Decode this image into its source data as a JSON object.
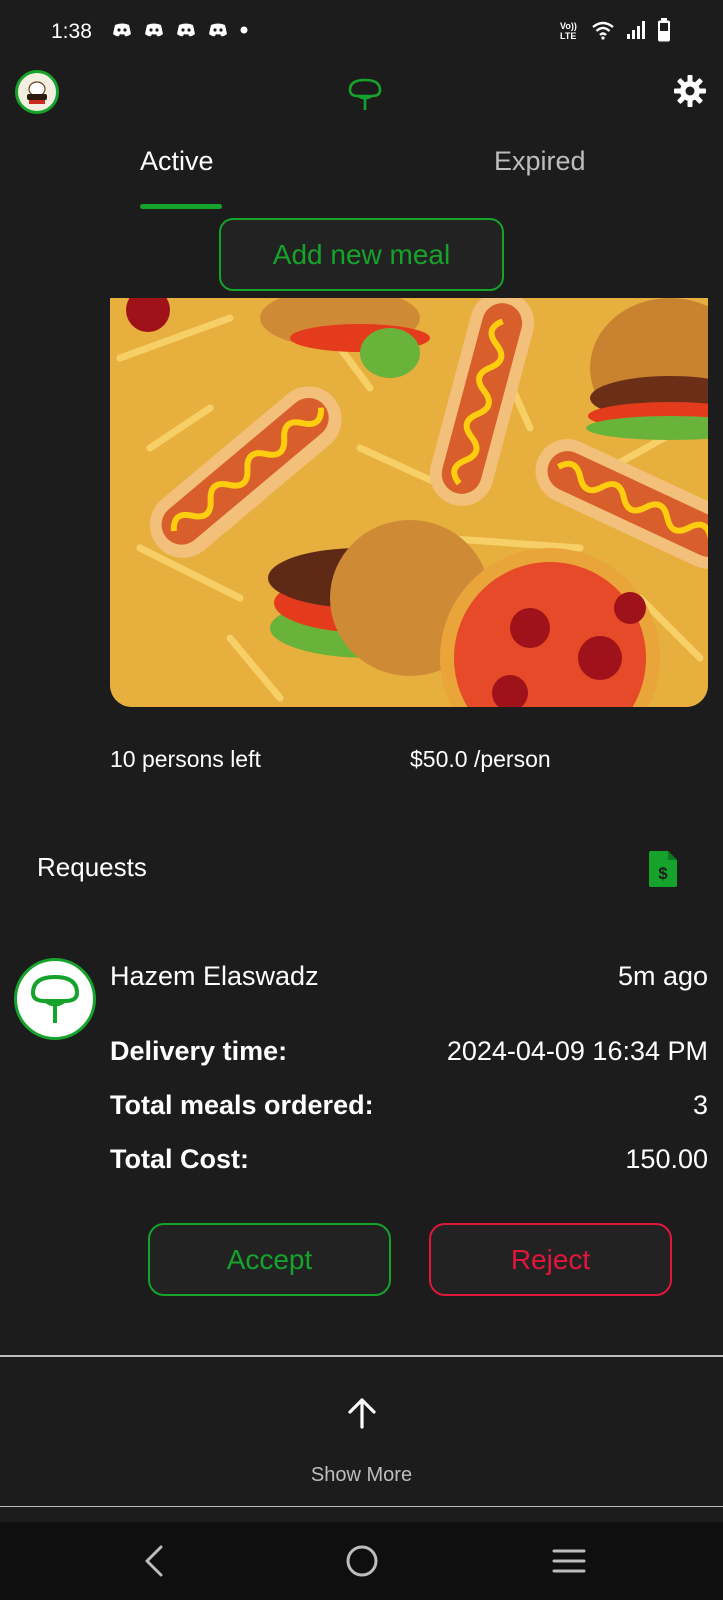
{
  "status_bar": {
    "time": "1:38",
    "left_icons": [
      "discord-icon",
      "discord-icon",
      "discord-icon",
      "discord-icon",
      "dot-icon"
    ],
    "right_icons": [
      "volte-icon",
      "wifi-icon",
      "signal-icon",
      "battery-icon"
    ]
  },
  "header": {
    "avatar_icon": "restaurant-logo-icon",
    "center_icon": "tree-logo-icon",
    "settings_icon": "gear-icon"
  },
  "tabs": [
    {
      "label": "Active",
      "selected": true
    },
    {
      "label": "Expired",
      "selected": false
    }
  ],
  "add_meal_label": "Add new meal",
  "meal": {
    "image_icon": "fast-food-photo",
    "persons_left": "10 persons left",
    "price": "$50.0 /person"
  },
  "requests": {
    "title": "Requests",
    "doc_icon": "invoice-icon",
    "items": [
      {
        "name": "Hazem Elaswadz",
        "time": "5m ago",
        "delivery_label": "Delivery time:",
        "delivery_value": "2024-04-09 16:34 PM",
        "meals_label": "Total meals ordered:",
        "meals_value": "3",
        "cost_label": "Total Cost:",
        "cost_value": "150.00",
        "accept_label": "Accept",
        "reject_label": "Reject"
      }
    ]
  },
  "show_more_label": "Show More",
  "colors": {
    "accent": "#16a32b",
    "danger": "#e0163b",
    "background": "#1c1c1c"
  }
}
